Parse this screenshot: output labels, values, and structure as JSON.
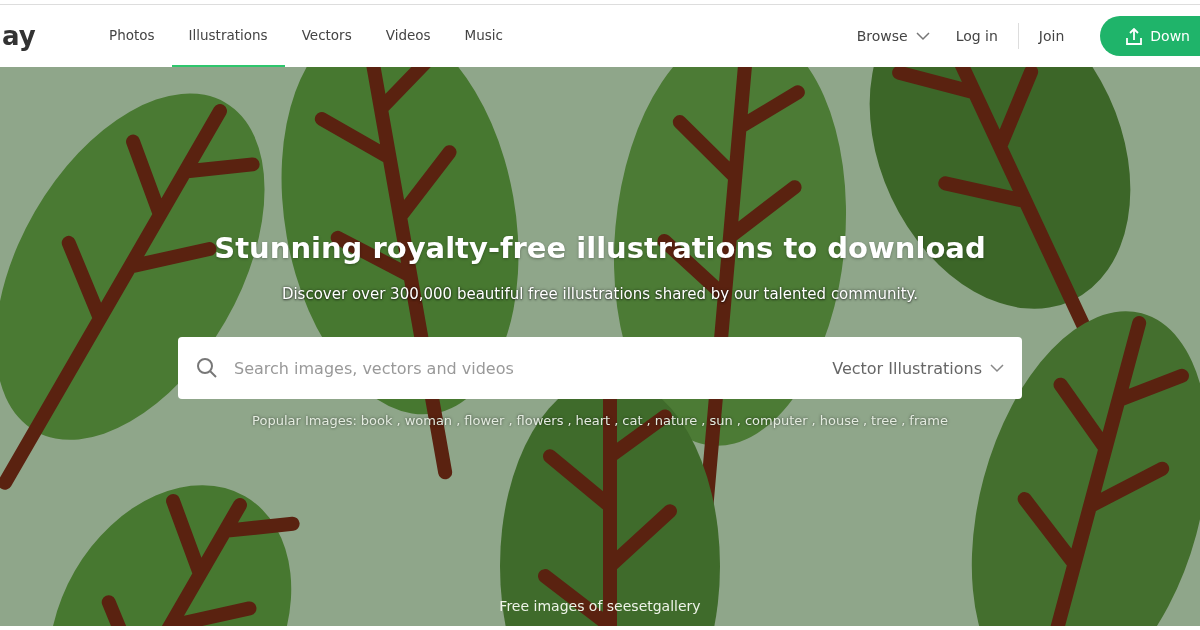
{
  "header": {
    "logo": "ay",
    "nav": [
      {
        "label": "Photos",
        "selected": false
      },
      {
        "label": "Illustrations",
        "selected": true
      },
      {
        "label": "Vectors",
        "selected": false
      },
      {
        "label": "Videos",
        "selected": false
      },
      {
        "label": "Music",
        "selected": false
      }
    ],
    "browse": "Browse",
    "login": "Log in",
    "join": "Join",
    "upload": "Down"
  },
  "hero": {
    "title": "Stunning royalty-free illustrations to download",
    "subtitle": "Discover over 300,000 beautiful free illustrations shared by our talented community.",
    "search": {
      "placeholder": "Search images, vectors and videos",
      "filter": "Vector Illustrations"
    },
    "popular": {
      "label": "Popular Images:",
      "separator": ",",
      "tags": [
        "book",
        "woman",
        "flower",
        "flowers",
        "heart",
        "cat",
        "nature",
        "sun",
        "computer",
        "house",
        "tree",
        "frame"
      ]
    },
    "credit": "Free images of seesetgallery"
  }
}
